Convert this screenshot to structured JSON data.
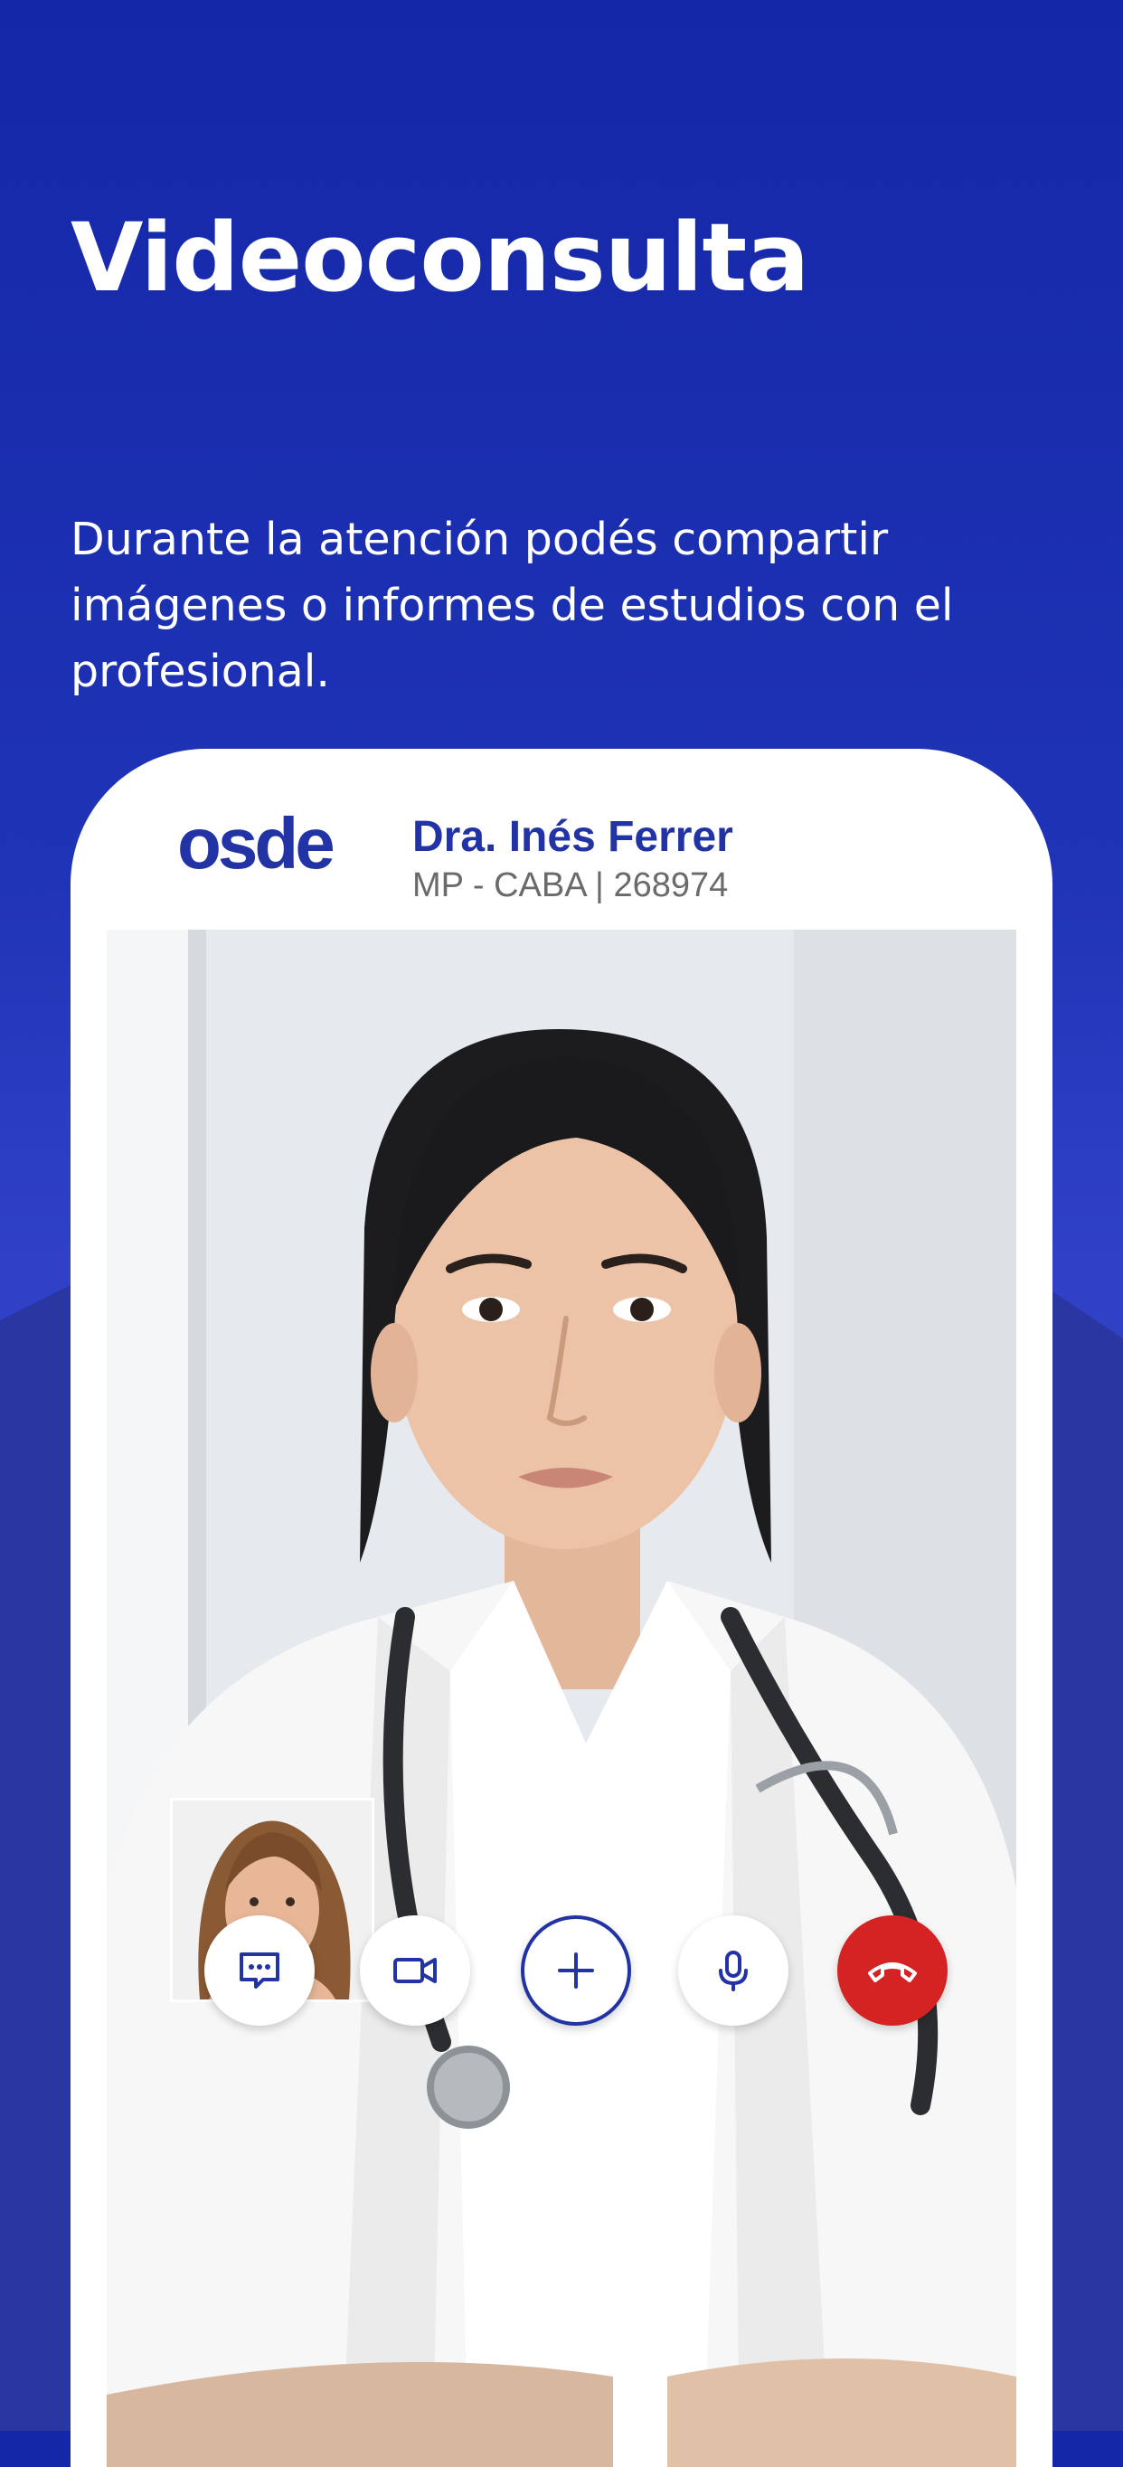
{
  "page": {
    "title": "Videoconsulta",
    "description": "Durante la atención podés compartir imágenes o informes de estudios con el profesional."
  },
  "call": {
    "logo_text": "osde",
    "doctor_name": "Dra. Inés Ferrer",
    "doctor_credentials": "MP - CABA | 268974",
    "controls": [
      {
        "name": "chat",
        "icon": "chat-icon"
      },
      {
        "name": "camera",
        "icon": "video-camera-icon"
      },
      {
        "name": "add",
        "icon": "plus-icon"
      },
      {
        "name": "microphone",
        "icon": "microphone-icon"
      },
      {
        "name": "hang-up",
        "icon": "phone-hangup-icon"
      }
    ]
  },
  "colors": {
    "brand_blue": "#2233a6",
    "background_blue": "#1f33b6",
    "hangup_red": "#d52222",
    "text_gray": "#6a6a6a"
  }
}
